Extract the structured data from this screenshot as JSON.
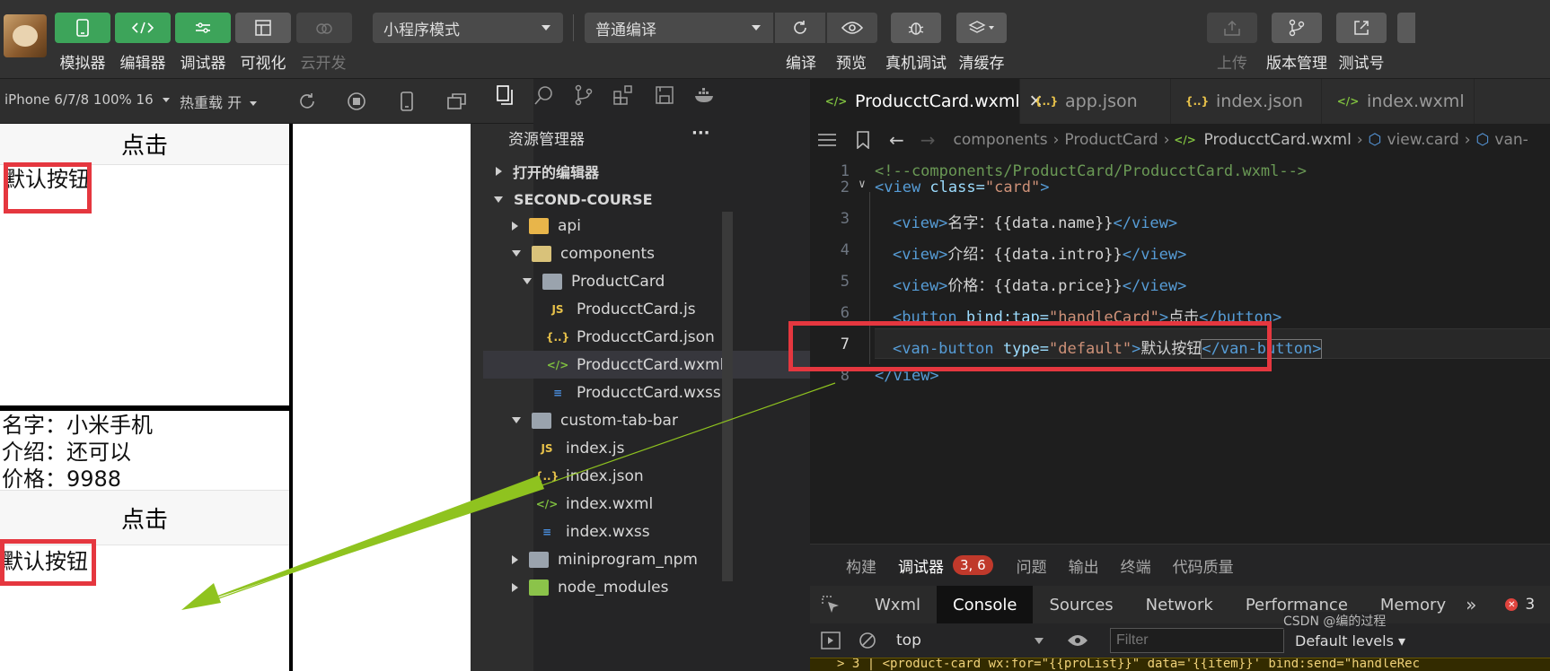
{
  "toolbar": {
    "left_buttons": [
      {
        "label": "模拟器",
        "icon": "phone-icon",
        "style": "green"
      },
      {
        "label": "编辑器",
        "icon": "code-icon",
        "style": "green"
      },
      {
        "label": "调试器",
        "icon": "debug-sliders-icon",
        "style": "green"
      },
      {
        "label": "可视化",
        "icon": "layout-icon",
        "style": "gray"
      },
      {
        "label": "云开发",
        "icon": "cloud-icon",
        "style": "disabled"
      }
    ],
    "mode_select": "小程序模式",
    "compile_select": "普通编译",
    "action_buttons": [
      {
        "label": "编译",
        "icon": "refresh-icon"
      },
      {
        "label": "预览",
        "icon": "eye-icon"
      },
      {
        "label": "真机调试",
        "icon": "bug-icon"
      },
      {
        "label": "清缓存",
        "icon": "layers-icon"
      }
    ],
    "right_buttons": [
      {
        "label": "上传",
        "icon": "upload-icon"
      },
      {
        "label": "版本管理",
        "icon": "branch-icon"
      },
      {
        "label": "测试号",
        "icon": "external-link-icon"
      }
    ]
  },
  "simulator": {
    "device": "iPhone 6/7/8 100% 16",
    "hot_reload": "热重载 开",
    "click_button": "点击",
    "default_button": "默认按钮",
    "product": {
      "name": "名字：小米手机",
      "intro": "介绍：还可以",
      "price": "价格：9988"
    }
  },
  "explorer": {
    "title": "资源管理器",
    "more": "···",
    "open_editors": "打开的编辑器",
    "project": "SECOND-COURSE",
    "items": [
      {
        "label": "api",
        "type": "folder",
        "state": "collapsed"
      },
      {
        "label": "components",
        "type": "folder",
        "state": "expanded"
      },
      {
        "label": "ProductCard",
        "type": "folder",
        "state": "expanded"
      },
      {
        "label": "ProducctCard.js",
        "type": "js"
      },
      {
        "label": "ProducctCard.json",
        "type": "json"
      },
      {
        "label": "ProducctCard.wxml",
        "type": "wxml",
        "selected": true
      },
      {
        "label": "ProducctCard.wxss",
        "type": "wxss"
      },
      {
        "label": "custom-tab-bar",
        "type": "folder",
        "state": "expanded"
      },
      {
        "label": "index.js",
        "type": "js"
      },
      {
        "label": "index.json",
        "type": "json"
      },
      {
        "label": "index.wxml",
        "type": "wxml"
      },
      {
        "label": "index.wxss",
        "type": "wxss"
      },
      {
        "label": "miniprogram_npm",
        "type": "folder",
        "state": "collapsed"
      },
      {
        "label": "node_modules",
        "type": "folder",
        "state": "collapsed"
      }
    ]
  },
  "editor": {
    "tabs": [
      {
        "label": "ProducctCard.wxml",
        "active": true,
        "icon": "wxml-file-icon"
      },
      {
        "label": "app.json",
        "icon": "json-file-icon"
      },
      {
        "label": "index.json",
        "icon": "json-file-icon"
      },
      {
        "label": "index.wxml",
        "icon": "wxml-file-icon"
      }
    ],
    "close_glyph": "✕",
    "breadcrumbs": [
      "components",
      "ProductCard",
      "ProducctCard.wxml",
      "view.card",
      "van-"
    ],
    "line_numbers": [
      "1",
      "2",
      "3",
      "4",
      "5",
      "6",
      "7",
      "8"
    ],
    "lines": [
      {
        "comment": "<!--components/ProductCard/ProducctCard.wxml-->"
      },
      {
        "open": "<view",
        "attr": " class=",
        "val": "\"card\"",
        "close": ">"
      },
      {
        "open": "<view>",
        "text": "名字：{{data.name}}",
        "end": "</view>"
      },
      {
        "open": "<view>",
        "text": "介绍：{{data.intro}}",
        "end": "</view>"
      },
      {
        "open": "<view>",
        "text": "价格：{{data.price}}",
        "end": "</view>"
      },
      {
        "open": "<button",
        "attr": " bind:tap=",
        "val": "\"handleCard\"",
        "close": ">",
        "text": "点击",
        "end": "</button>"
      },
      {
        "open": "<van-button",
        "attr": " type=",
        "val": "\"default\"",
        "close": ">",
        "text": "默认按钮",
        "end": "</van-button>"
      },
      {
        "end": "</view>"
      }
    ]
  },
  "debugger": {
    "tabs": [
      "构建",
      "调试器",
      "问题",
      "输出",
      "终端",
      "代码质量"
    ],
    "badge": "3, 6",
    "console_tabs": [
      "Wxml",
      "Console",
      "Sources",
      "Network",
      "Performance",
      "Memory"
    ],
    "more_tabs": "»",
    "error_count": "3",
    "context": "top",
    "filter_placeholder": "Filter",
    "levels": "Default levels",
    "console_line": "> 3 | <product-card wx:for=\"{{proList}}\" data='{{item}}'  bind:send=\"handleRec",
    "watermark": "CSDN @编的过程"
  },
  "colors": {
    "accent_green": "#3da45a",
    "highlight_red": "#e5373f",
    "arrow": "#8fc31f"
  }
}
